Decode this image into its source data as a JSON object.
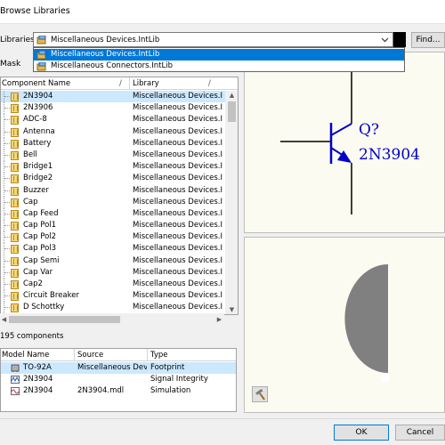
{
  "window": {
    "title": "Browse Libraries"
  },
  "libraries": {
    "label": "Libraries",
    "selected": "Miscellaneous Devices.IntLib",
    "options": [
      "Miscellaneous Devices.IntLib",
      "Miscellaneous Connectors.IntLib"
    ],
    "find_label": "Find..."
  },
  "mask": {
    "label": "Mask"
  },
  "components": {
    "headers": {
      "name": "Component Name",
      "library": "Library"
    },
    "rows": [
      {
        "name": "2N3904",
        "library": "Miscellaneous Devices.I"
      },
      {
        "name": "2N3906",
        "library": "Miscellaneous Devices.I"
      },
      {
        "name": "ADC-8",
        "library": "Miscellaneous Devices.I"
      },
      {
        "name": "Antenna",
        "library": "Miscellaneous Devices.I"
      },
      {
        "name": "Battery",
        "library": "Miscellaneous Devices.I"
      },
      {
        "name": "Bell",
        "library": "Miscellaneous Devices.I"
      },
      {
        "name": "Bridge1",
        "library": "Miscellaneous Devices.I"
      },
      {
        "name": "Bridge2",
        "library": "Miscellaneous Devices.I"
      },
      {
        "name": "Buzzer",
        "library": "Miscellaneous Devices.I"
      },
      {
        "name": "Cap",
        "library": "Miscellaneous Devices.I"
      },
      {
        "name": "Cap Feed",
        "library": "Miscellaneous Devices.I"
      },
      {
        "name": "Cap Pol1",
        "library": "Miscellaneous Devices.I"
      },
      {
        "name": "Cap Pol2",
        "library": "Miscellaneous Devices.I"
      },
      {
        "name": "Cap Pol3",
        "library": "Miscellaneous Devices.I"
      },
      {
        "name": "Cap Semi",
        "library": "Miscellaneous Devices.I"
      },
      {
        "name": "Cap Var",
        "library": "Miscellaneous Devices.I"
      },
      {
        "name": "Cap2",
        "library": "Miscellaneous Devices.I"
      },
      {
        "name": "Circuit Breaker",
        "library": "Miscellaneous Devices.I"
      },
      {
        "name": "D Schottky",
        "library": "Miscellaneous Devices.I"
      }
    ],
    "count_text": "195 components"
  },
  "models": {
    "headers": {
      "name": "Model Name",
      "source": "Source",
      "type": "Type"
    },
    "rows": [
      {
        "name": "TO-92A",
        "source": "Miscellaneous Devi",
        "type": "Footprint"
      },
      {
        "name": "2N3904",
        "source": "",
        "type": "Signal Integrity"
      },
      {
        "name": "2N3904",
        "source": "2N3904.mdl",
        "type": "Simulation"
      }
    ]
  },
  "preview": {
    "designator": "Q?",
    "comment": "2N3904"
  },
  "buttons": {
    "ok": "OK",
    "cancel": "Cancel"
  },
  "colors": {
    "selection": "#0078d7",
    "row_highlight": "#cce8ff",
    "symbol": "#0000c8",
    "preview_bg": "#fbfbf1",
    "footprint": "#808080"
  }
}
